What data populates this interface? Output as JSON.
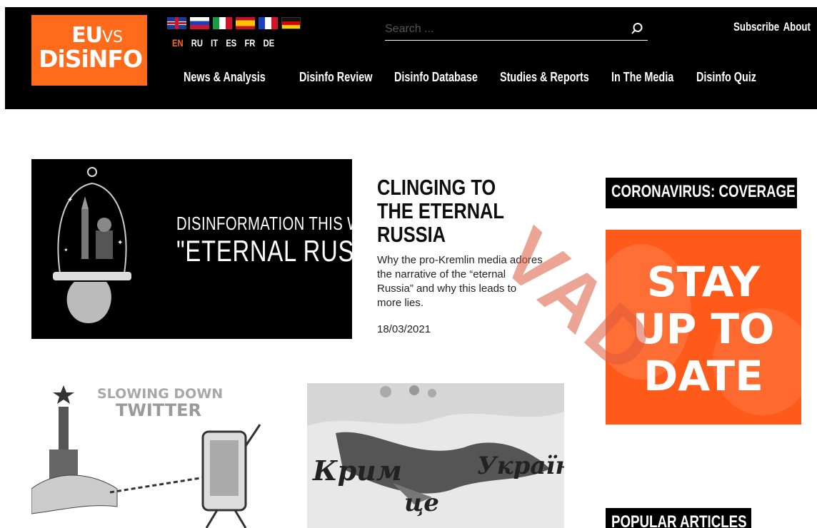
{
  "header": {
    "logo": {
      "line1": "EU",
      "line1_suffix": "VS",
      "line2": "DiSiNFO"
    },
    "languages": [
      {
        "code": "EN",
        "flag": "uk",
        "active": true
      },
      {
        "code": "RU",
        "flag": "ru",
        "active": false
      },
      {
        "code": "IT",
        "flag": "it",
        "active": false
      },
      {
        "code": "ES",
        "flag": "es",
        "active": false
      },
      {
        "code": "FR",
        "flag": "fr",
        "active": false
      },
      {
        "code": "DE",
        "flag": "de",
        "active": false
      }
    ],
    "search": {
      "placeholder": "Search ...",
      "icon": "search-icon"
    },
    "top_links": [
      "Subscribe",
      "About"
    ],
    "nav": [
      {
        "label": "News & Analysis",
        "has_dropdown": true
      },
      {
        "label": "Disinfo Review"
      },
      {
        "label": "Disinfo Database"
      },
      {
        "label": "Studies & Reports"
      },
      {
        "label": "In The Media"
      },
      {
        "label": "Disinfo Quiz"
      }
    ]
  },
  "featured": {
    "image_text_line1": "DISINFORMATION THIS WEEK:",
    "image_text_line2": "\"ETERNAL RUSSIA\"",
    "title": "CLINGING TO THE ETERNAL RUSSIA",
    "excerpt": "Why the pro-Kremlin media adores the narrative of the “eternal Russia” and why this leads to more lies.",
    "date": "18/03/2021"
  },
  "thumbnails": [
    {
      "text_line1": "SLOWING DOWN",
      "text_line2": "TWITTER"
    },
    {
      "text_line1": "Крим",
      "text_line2": "це",
      "text_line3": "Україна!"
    }
  ],
  "sidebar": {
    "coronavirus_heading": "CORONAVIRUS: COVERAGE",
    "banner": {
      "line1": "STAY",
      "line2": "UP TO",
      "line3": "DATE"
    },
    "popular_heading": "POPULAR ARTICLES"
  },
  "watermark": "VAD",
  "colors": {
    "brand_orange": "#ff6b1a",
    "topbar": "#000000",
    "banner_orange": "#ff5a1a"
  }
}
